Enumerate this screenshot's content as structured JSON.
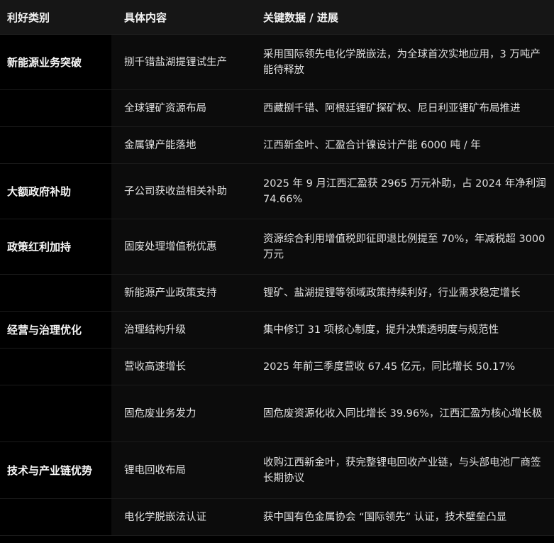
{
  "headers": {
    "category": "利好类别",
    "content": "具体内容",
    "detail": "关键数据 / 进展"
  },
  "rows": [
    {
      "category": "新能源业务突破",
      "content": "捌千错盐湖提锂试生产",
      "detail": "采用国际领先电化学脱嵌法，为全球首次实地应用，3 万吨产能待释放"
    },
    {
      "category": "",
      "content": "全球锂矿资源布局",
      "detail": "西藏捌千错、阿根廷锂矿探矿权、尼日利亚锂矿布局推进"
    },
    {
      "category": "",
      "content": "金属镍产能落地",
      "detail": "江西新金叶、汇盈合计镍设计产能 6000 吨 / 年"
    },
    {
      "category": "大额政府补助",
      "content": "子公司获收益相关补助",
      "detail": "2025 年 9 月江西汇盈获 2965 万元补助，占 2024 年净利润 74.66%"
    },
    {
      "category": "政策红利加持",
      "content": "固废处理增值税优惠",
      "detail": "资源综合利用增值税即征即退比例提至 70%，年减税超 3000 万元"
    },
    {
      "category": "",
      "content": "新能源产业政策支持",
      "detail": "锂矿、盐湖提锂等领域政策持续利好，行业需求稳定增长"
    },
    {
      "category": "经营与治理优化",
      "content": "治理结构升级",
      "detail": "集中修订 31 项核心制度，提升决策透明度与规范性"
    },
    {
      "category": "",
      "content": "营收高速增长",
      "detail": "2025 年前三季度营收 67.45 亿元，同比增长 50.17%"
    },
    {
      "category": "",
      "content": "固危废业务发力",
      "detail": "固危废资源化收入同比增长 39.96%，江西汇盈为核心增长极"
    },
    {
      "category": "技术与产业链优势",
      "content": "锂电回收布局",
      "detail": "收购江西新金叶，获完整锂电回收产业链，与头部电池厂商签长期协议"
    },
    {
      "category": "",
      "content": "电化学脱嵌法认证",
      "detail": "获中国有色金属协会 “国际领先” 认证，技术壁垒凸显"
    }
  ]
}
